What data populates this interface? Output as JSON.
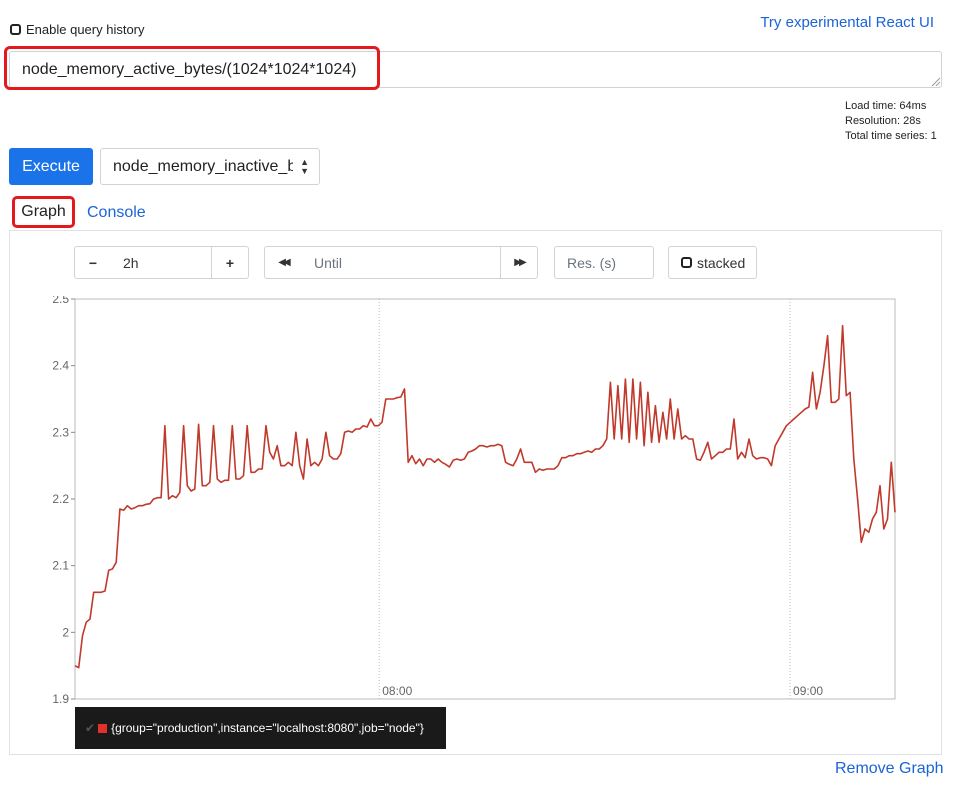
{
  "header": {
    "history_label": "Enable query history",
    "react_link": "Try experimental React UI"
  },
  "query": {
    "expression": "node_memory_active_bytes/(1024*1024*1024)"
  },
  "stats": {
    "load_time": "Load time: 64ms",
    "resolution": "Resolution: 28s",
    "total_series": "Total time series: 1"
  },
  "controls": {
    "execute_label": "Execute",
    "metric_selected": "node_memory_inactive_bytes"
  },
  "tabs": {
    "graph": "Graph",
    "console": "Console"
  },
  "graph_controls": {
    "minus": "−",
    "range": "2h",
    "plus": "+",
    "back": "◀◀",
    "until_placeholder": "Until",
    "forward": "▶▶",
    "res_placeholder": "Res. (s)",
    "stacked": "stacked"
  },
  "legend": {
    "series_label": "{group=\"production\",instance=\"localhost:8080\",job=\"node\"}",
    "series_color": "#c0392b"
  },
  "remove_graph": "Remove Graph",
  "colors": {
    "primary": "#1a73e8",
    "link": "#1a64d8",
    "highlight": "#e3191c",
    "series": "#c0392b"
  },
  "chart_data": {
    "type": "line",
    "ylim": [
      1.9,
      2.5
    ],
    "yticks": [
      "1.9",
      "2",
      "2.1",
      "2.2",
      "2.3",
      "2.4",
      "2.5"
    ],
    "xticks": [
      {
        "label": "08:00",
        "t": 0.371
      },
      {
        "label": "09:00",
        "t": 0.872
      }
    ],
    "grid": true,
    "series": [
      {
        "name": "{group=\"production\",instance=\"localhost:8080\",job=\"node\"}",
        "values": [
          1.95,
          1.947,
          1.995,
          2.015,
          2.02,
          2.06,
          2.06,
          2.06,
          2.062,
          2.093,
          2.095,
          2.105,
          2.185,
          2.183,
          2.19,
          2.185,
          2.187,
          2.19,
          2.19,
          2.192,
          2.193,
          2.2,
          2.202,
          2.202,
          2.31,
          2.2,
          2.205,
          2.202,
          2.21,
          2.31,
          2.22,
          2.212,
          2.215,
          2.312,
          2.22,
          2.22,
          2.225,
          2.31,
          2.23,
          2.225,
          2.228,
          2.228,
          2.31,
          2.23,
          2.23,
          2.235,
          2.31,
          2.24,
          2.24,
          2.245,
          2.245,
          2.31,
          2.27,
          2.26,
          2.28,
          2.25,
          2.25,
          2.255,
          2.25,
          2.3,
          2.25,
          2.23,
          2.29,
          2.25,
          2.255,
          2.25,
          2.26,
          2.3,
          2.265,
          2.26,
          2.26,
          2.268,
          2.3,
          2.302,
          2.3,
          2.305,
          2.305,
          2.31,
          2.308,
          2.32,
          2.31,
          2.31,
          2.315,
          2.35,
          2.35,
          2.35,
          2.352,
          2.353,
          2.365,
          2.255,
          2.265,
          2.253,
          2.26,
          2.25,
          2.26,
          2.26,
          2.255,
          2.26,
          2.255,
          2.252,
          2.248,
          2.258,
          2.26,
          2.258,
          2.26,
          2.27,
          2.272,
          2.275,
          2.28,
          2.28,
          2.278,
          2.28,
          2.28,
          2.282,
          2.28,
          2.255,
          2.252,
          2.25,
          2.26,
          2.275,
          2.255,
          2.255,
          2.255,
          2.24,
          2.245,
          2.243,
          2.245,
          2.245,
          2.245,
          2.25,
          2.262,
          2.262,
          2.265,
          2.265,
          2.268,
          2.268,
          2.27,
          2.272,
          2.27,
          2.275,
          2.275,
          2.28,
          2.29,
          2.375,
          2.29,
          2.37,
          2.29,
          2.38,
          2.285,
          2.38,
          2.29,
          2.375,
          2.28,
          2.36,
          2.285,
          2.34,
          2.285,
          2.33,
          2.29,
          2.35,
          2.29,
          2.335,
          2.29,
          2.295,
          2.29,
          2.29,
          2.26,
          2.258,
          2.27,
          2.285,
          2.26,
          2.265,
          2.27,
          2.27,
          2.275,
          2.275,
          2.32,
          2.26,
          2.27,
          2.262,
          2.29,
          2.265,
          2.26,
          2.262,
          2.262,
          2.26,
          2.25,
          2.28,
          2.29,
          2.3,
          2.31,
          2.315,
          2.32,
          2.325,
          2.33,
          2.335,
          2.338,
          2.39,
          2.335,
          2.36,
          2.4,
          2.445,
          2.345,
          2.345,
          2.35,
          2.46,
          2.355,
          2.36,
          2.26,
          2.2,
          2.135,
          2.155,
          2.15,
          2.17,
          2.18,
          2.22,
          2.155,
          2.17,
          2.255,
          2.18
        ]
      }
    ]
  }
}
